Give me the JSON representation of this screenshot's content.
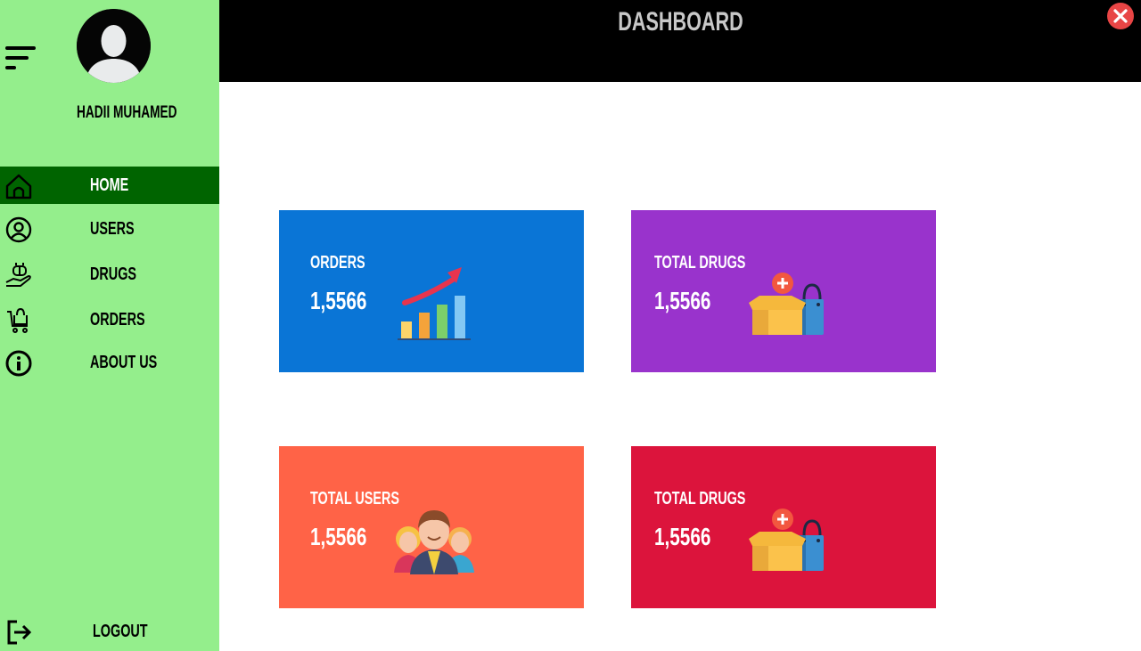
{
  "sidebar": {
    "user_name": "HADII MUHAMED",
    "items": [
      {
        "label": "HOME",
        "icon": "home-icon",
        "active": true
      },
      {
        "label": "USERS",
        "icon": "user-circle-icon",
        "active": false
      },
      {
        "label": "DRUGS",
        "icon": "drugs-hand-icon",
        "active": false
      },
      {
        "label": "ORDERS",
        "icon": "cart-icon",
        "active": false
      },
      {
        "label": "ABOUT US",
        "icon": "info-icon",
        "active": false
      }
    ],
    "logout_label": "LOGOUT"
  },
  "header": {
    "title": "DASHBOARD"
  },
  "cards": [
    {
      "title": "ORDERS",
      "value": "1,5566",
      "color": "#0a75d6",
      "icon": "growth-chart-icon"
    },
    {
      "title": "TOTAL DRUGS",
      "value": "1,5566",
      "color": "#9933cc",
      "icon": "box-bag-icon"
    },
    {
      "title": "TOTAL USERS",
      "value": "1,5566",
      "color": "#ff6347",
      "icon": "users-group-icon"
    },
    {
      "title": "TOTAL DRUGS",
      "value": "1,5566",
      "color": "#dc143c",
      "icon": "box-bag-icon"
    }
  ],
  "colors": {
    "sidebar_bg": "#94ee8c",
    "active_item_bg": "#006400",
    "header_bg": "#000000",
    "close_button": "#e84545"
  }
}
